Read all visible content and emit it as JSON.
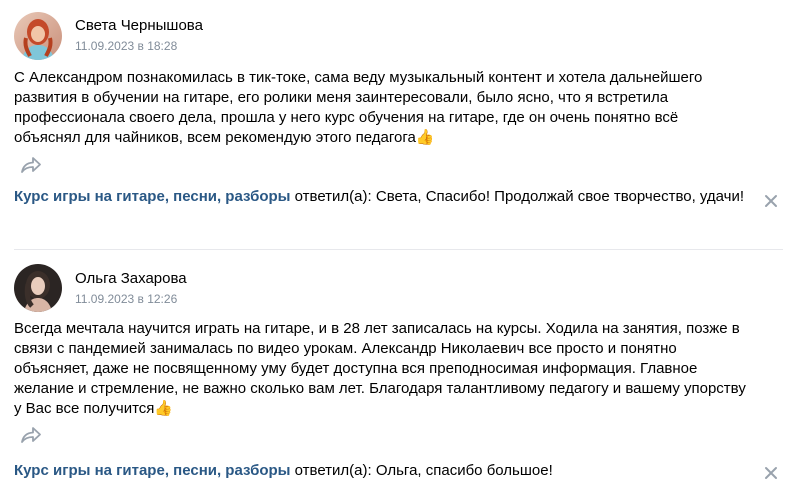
{
  "reviews": [
    {
      "author": "Света Чернышова",
      "date": "11.09.2023 в 18:28",
      "text": "С Александром познакомилась в тик-токе, сама веду музыкальный контент и хотела дальнейшего развития в обучении на гитаре, его ролики меня заинтересовали, было ясно, что я встретила профессионала своего дела, прошла у него курс обучения на гитаре, где он очень понятно всё объяснял для чайников, всем рекомендую этого педагога",
      "emoji": "👍",
      "reply_author": "Курс игры на гитаре, песни, разборы",
      "reply_verb": " ответил(а): ",
      "reply_text": "Света, Спасибо! Продолжай свое творчество, удачи!"
    },
    {
      "author": "Ольга Захарова",
      "date": "11.09.2023 в 12:26",
      "text": "Всегда мечтала научится играть на гитаре, и в 28 лет записалась на курсы. Ходила на занятия, позже в связи с пандемией занималась по видео урокам. Александр Николаевич все просто и понятно объясняет, даже не посвященному уму будет доступна вся преподносимая информация. Главное желание и стремление, не важно сколько вам лет. Благодаря талантливому педагогу и вашему упорству у Вас все получится",
      "emoji": "👍",
      "reply_author": "Курс игры на гитаре, песни, разборы",
      "reply_verb": " ответил(а): ",
      "reply_text": "Ольга, спасибо большое!"
    }
  ],
  "icons": {
    "share": "share-icon",
    "close": "close-icon"
  },
  "colors": {
    "link": "#2a5885",
    "meta": "#818c99",
    "icon": "#99a2ad",
    "divider": "#e7e8ec"
  }
}
